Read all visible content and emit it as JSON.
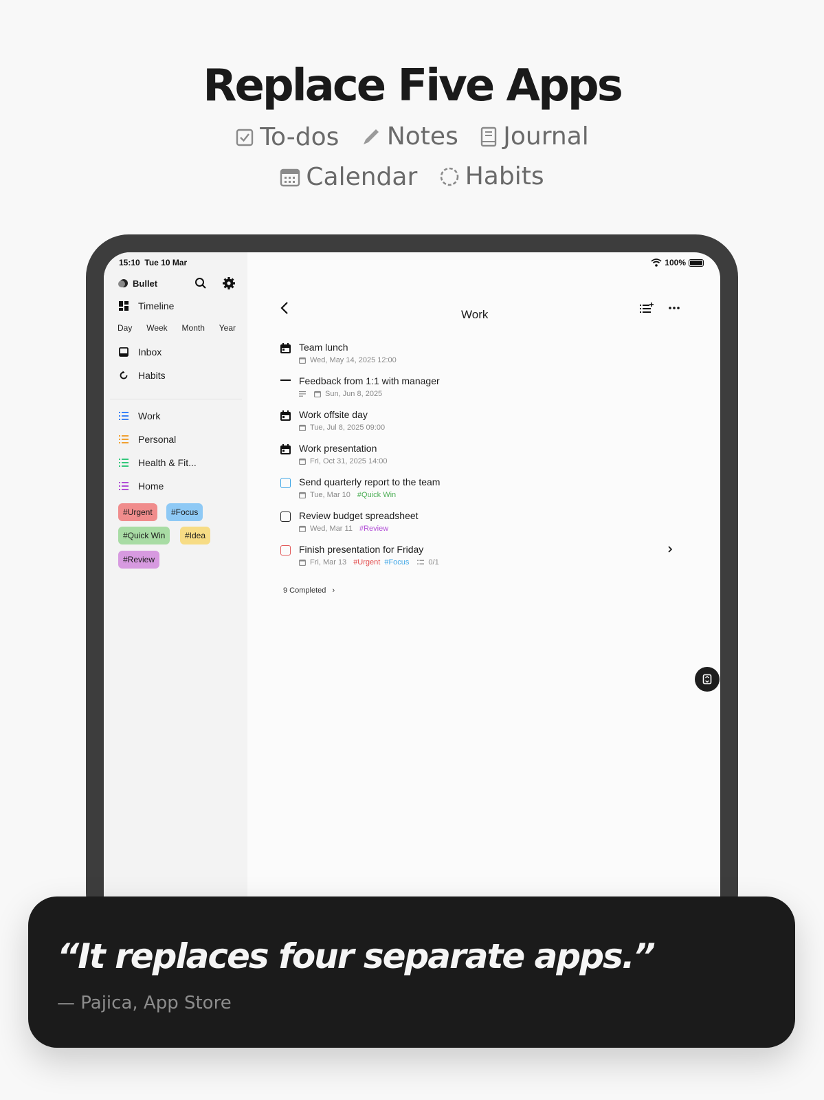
{
  "headline": "Replace Five Apps",
  "features": [
    {
      "label": "To-dos",
      "icon": "checkbox-icon"
    },
    {
      "label": "Notes",
      "icon": "pencil-icon"
    },
    {
      "label": "Journal",
      "icon": "book-icon"
    },
    {
      "label": "Calendar",
      "icon": "calendar-icon"
    },
    {
      "label": "Habits",
      "icon": "dashed-circle-icon"
    }
  ],
  "status_bar": {
    "time": "15:10",
    "date": "Tue 10 Mar",
    "battery": "100%"
  },
  "sidebar": {
    "app_name": "Bullet",
    "timeline": "Timeline",
    "periods": [
      "Day",
      "Week",
      "Month",
      "Year"
    ],
    "inbox": "Inbox",
    "habits": "Habits",
    "lists": [
      {
        "label": "Work",
        "color": "#3b82f6"
      },
      {
        "label": "Personal",
        "color": "#f0a030"
      },
      {
        "label": "Health & Fit...",
        "color": "#34c77b"
      },
      {
        "label": "Home",
        "color": "#b14fd6"
      }
    ],
    "tags": [
      {
        "label": "#Urgent",
        "bg": "#f08c8c"
      },
      {
        "label": "#Focus",
        "bg": "#8ec9f5"
      },
      {
        "label": "#Quick Win",
        "bg": "#a8dca4"
      },
      {
        "label": "#Idea",
        "bg": "#f7dc85"
      },
      {
        "label": "#Review",
        "bg": "#d79ae0"
      }
    ]
  },
  "main": {
    "title": "Work",
    "tasks": [
      {
        "title": "Team lunch",
        "type": "event",
        "date": "Wed, May 14, 2025 12:00",
        "tags": []
      },
      {
        "title": "Feedback from 1:1 with manager",
        "type": "note",
        "date": "Sun, Jun 8, 2025",
        "tags": []
      },
      {
        "title": "Work offsite day",
        "type": "event",
        "date": "Tue, Jul 8, 2025 09:00",
        "tags": []
      },
      {
        "title": "Work presentation",
        "type": "event",
        "date": "Fri, Oct 31, 2025 14:00",
        "tags": []
      },
      {
        "title": "Send quarterly report to the team",
        "type": "todo",
        "check_color": "#3fa6e6",
        "date": "Tue, Mar 10",
        "tags": [
          {
            "label": "#Quick Win",
            "color": "#4cae55"
          }
        ]
      },
      {
        "title": "Review budget spreadsheet",
        "type": "todo",
        "check_color": "#2a2a2a",
        "date": "Wed, Mar 11",
        "tags": [
          {
            "label": "#Review",
            "color": "#b14fd6"
          }
        ]
      },
      {
        "title": "Finish presentation for Friday",
        "type": "todo",
        "check_color": "#e25b5b",
        "date": "Fri, Mar 13",
        "tags": [
          {
            "label": "#Urgent",
            "color": "#e24b4b"
          },
          {
            "label": "#Focus",
            "color": "#3fa6e6"
          }
        ],
        "subtasks": "0/1"
      }
    ],
    "completed": "9 Completed"
  },
  "quote": {
    "text": "“It replaces four separate apps.”",
    "attribution": "— Pajica, App Store"
  }
}
